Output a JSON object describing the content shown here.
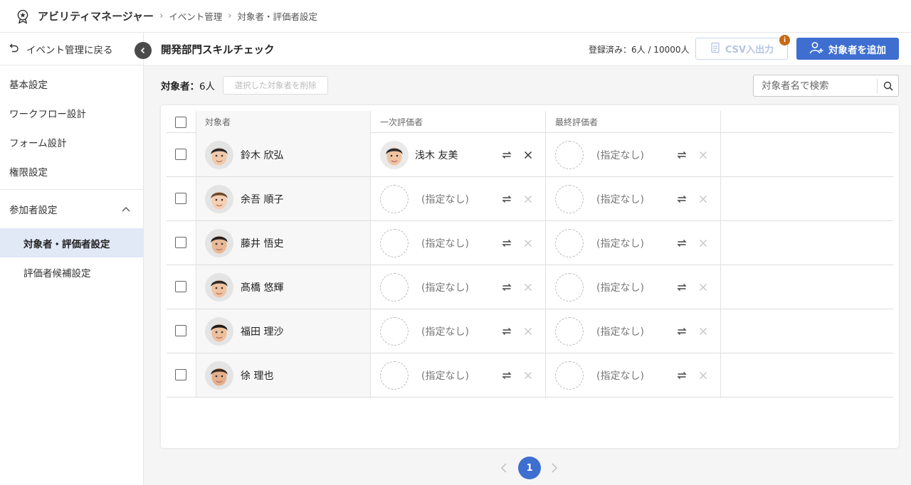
{
  "topbar": {
    "app_title": "アビリティマネージャー",
    "breadcrumbs": [
      "イベント管理",
      "対象者・評価者設定"
    ],
    "icons": {
      "logo": "award-badge-icon",
      "separator": "chevron-right-icon"
    }
  },
  "sidebar": {
    "back_label": "イベント管理に戻る",
    "items": [
      {
        "label": "基本設定"
      },
      {
        "label": "ワークフロー設計"
      },
      {
        "label": "フォーム設計"
      },
      {
        "label": "権限設定"
      }
    ],
    "group": {
      "label": "参加者設定",
      "expanded": true,
      "children": [
        {
          "label": "対象者・評価者設定",
          "active": true
        },
        {
          "label": "評価者候補設定",
          "active": false
        }
      ]
    }
  },
  "header": {
    "title": "開発部門スキルチェック",
    "registered_label": "登録済み：6人 / 10000人",
    "csv_button_label": "CSV入出力",
    "info_badge": "i",
    "add_button_label": "対象者を追加"
  },
  "toolbar": {
    "count_label": "対象者：",
    "count_value": "6人",
    "delete_label": "選択した対象者を削除",
    "search_placeholder": "対象者名で検索"
  },
  "table": {
    "columns": [
      "対象者",
      "一次評価者",
      "最終評価者"
    ],
    "unset_label": "(指定なし)",
    "rows": [
      {
        "name": "鈴木 欣弘",
        "first": "浅木 友美",
        "final": null
      },
      {
        "name": "余吾 順子",
        "first": null,
        "final": null
      },
      {
        "name": "藤井 悟史",
        "first": null,
        "final": null
      },
      {
        "name": "髙橋 悠輝",
        "first": null,
        "final": null
      },
      {
        "name": "福田 理沙",
        "first": null,
        "final": null
      },
      {
        "name": "徐 理也",
        "first": null,
        "final": null
      }
    ]
  },
  "pagination": {
    "current": "1"
  },
  "colors": {
    "accent": "#3e6fd0",
    "active_nav": "#e1e8f6",
    "info_badge": "#c96a12"
  }
}
